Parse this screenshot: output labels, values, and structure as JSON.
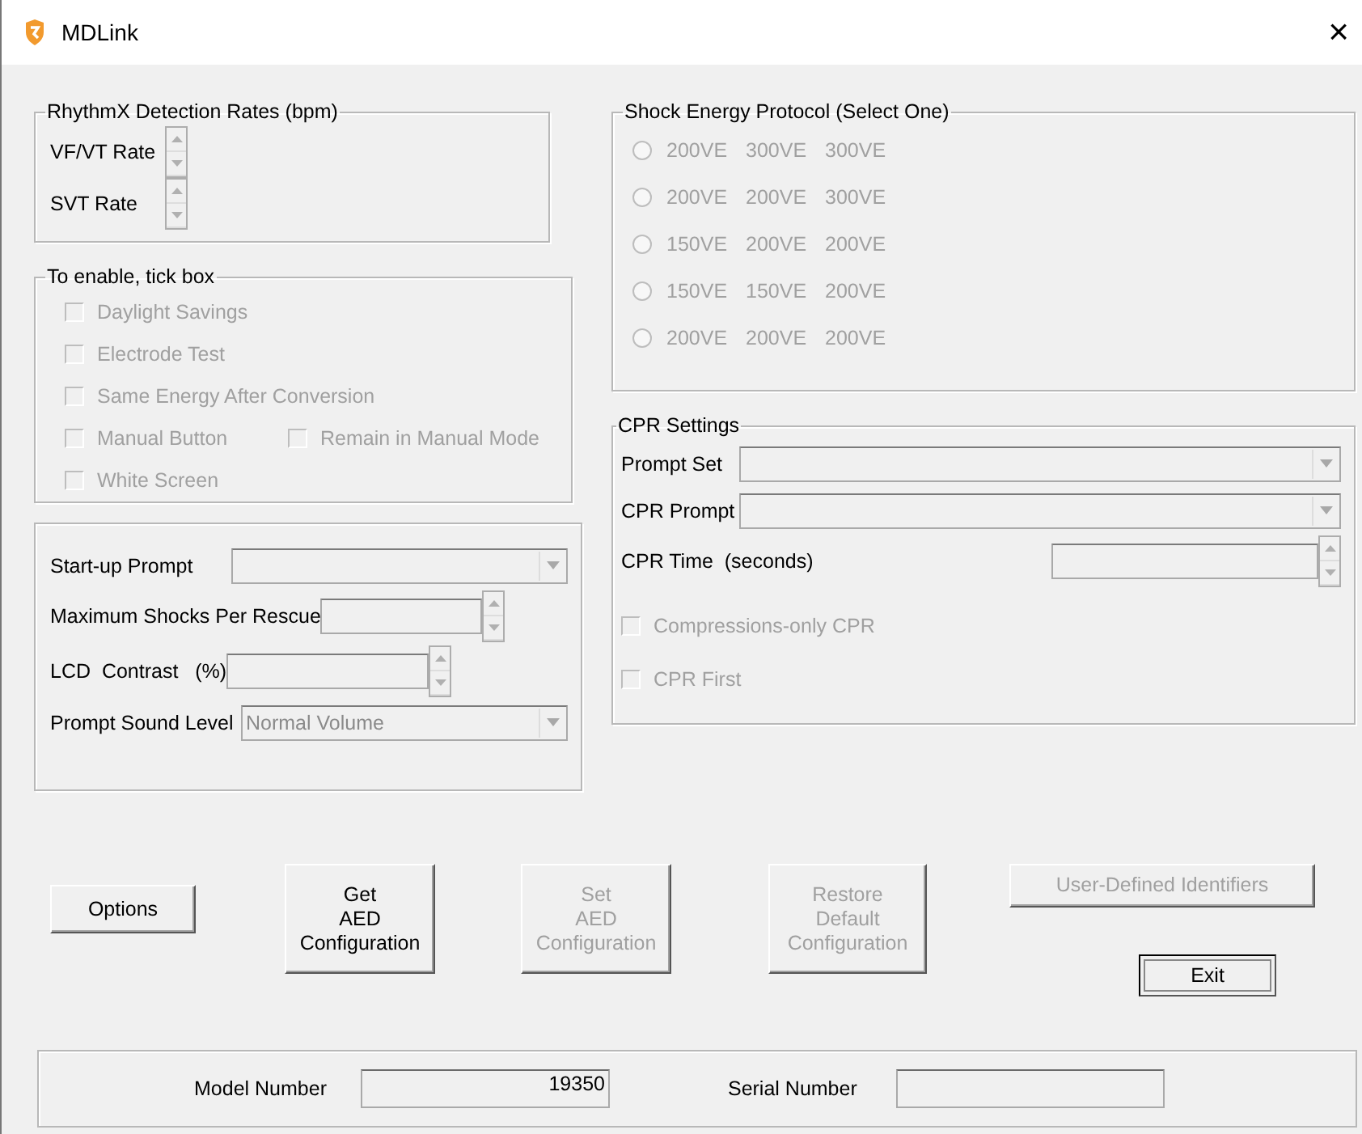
{
  "window": {
    "title": "MDLink",
    "close": "×"
  },
  "rhythm_group": {
    "title": "RhythmX Detection Rates (bpm)",
    "rows": [
      {
        "label": "VF/VT Rate"
      },
      {
        "label": "SVT Rate"
      }
    ]
  },
  "enable_group": {
    "title": "To enable, tick box",
    "options": [
      {
        "label": "Daylight Savings",
        "checked": false,
        "disabled": true
      },
      {
        "label": "Electrode Test",
        "checked": false,
        "disabled": true
      },
      {
        "label": "Same Energy After Conversion",
        "checked": false,
        "disabled": true
      },
      {
        "label": "Manual Button",
        "checked": false,
        "disabled": true,
        "companion": {
          "label": "Remain in Manual Mode",
          "checked": false,
          "disabled": true
        }
      },
      {
        "label": "White Screen",
        "checked": false,
        "disabled": true
      }
    ]
  },
  "settings_group": {
    "fields": [
      {
        "kind": "dropdown",
        "label": "Start-up Prompt",
        "disabled": true
      },
      {
        "kind": "spinner",
        "label": "Maximum Shocks Per Rescue",
        "disabled": true
      },
      {
        "kind": "spinner",
        "label": "LCD  Contrast   (%)",
        "disabled": true
      },
      {
        "kind": "dropdown",
        "label": "Prompt Sound Level",
        "value": "Normal Volume",
        "disabled": true
      }
    ]
  },
  "shock_group": {
    "title": "Shock Energy Protocol (Select One)",
    "options": [
      {
        "levels": [
          "200VE",
          "300VE",
          "300VE"
        ],
        "selected": false,
        "disabled": true
      },
      {
        "levels": [
          "200VE",
          "200VE",
          "300VE"
        ],
        "selected": false,
        "disabled": true
      },
      {
        "levels": [
          "150VE",
          "200VE",
          "200VE"
        ],
        "selected": false,
        "disabled": true
      },
      {
        "levels": [
          "150VE",
          "150VE",
          "200VE"
        ],
        "selected": false,
        "disabled": true
      },
      {
        "levels": [
          "200VE",
          "200VE",
          "200VE"
        ],
        "selected": false,
        "disabled": true
      }
    ]
  },
  "cpr_group": {
    "title": "CPR Settings",
    "fields": [
      {
        "kind": "dropdown",
        "label": "Prompt Set",
        "disabled": true
      },
      {
        "kind": "dropdown",
        "label": "CPR Prompt",
        "disabled": true
      },
      {
        "kind": "spinner",
        "label": "CPR Time  (seconds)",
        "disabled": true
      }
    ],
    "options": [
      {
        "label": "Compressions-only CPR",
        "checked": false,
        "disabled": true
      },
      {
        "label": "CPR First",
        "checked": false,
        "disabled": true
      }
    ]
  },
  "buttons": [
    {
      "lines": [
        "Options"
      ],
      "disabled": false,
      "focused": false
    },
    {
      "lines": [
        "Get",
        "AED",
        "Configuration"
      ],
      "disabled": false,
      "focused": false
    },
    {
      "lines": [
        "Set",
        "AED",
        "Configuration"
      ],
      "disabled": true,
      "focused": false
    },
    {
      "lines": [
        "Restore",
        "Default",
        "Configuration"
      ],
      "disabled": true,
      "focused": false
    },
    {
      "lines": [
        "User-Defined Identifiers"
      ],
      "disabled": true,
      "focused": false
    },
    {
      "lines": [
        "Exit"
      ],
      "disabled": false,
      "focused": true
    }
  ],
  "footer": {
    "model_label": "Model Number",
    "model_value": "19350",
    "serial_label": "Serial Number"
  }
}
